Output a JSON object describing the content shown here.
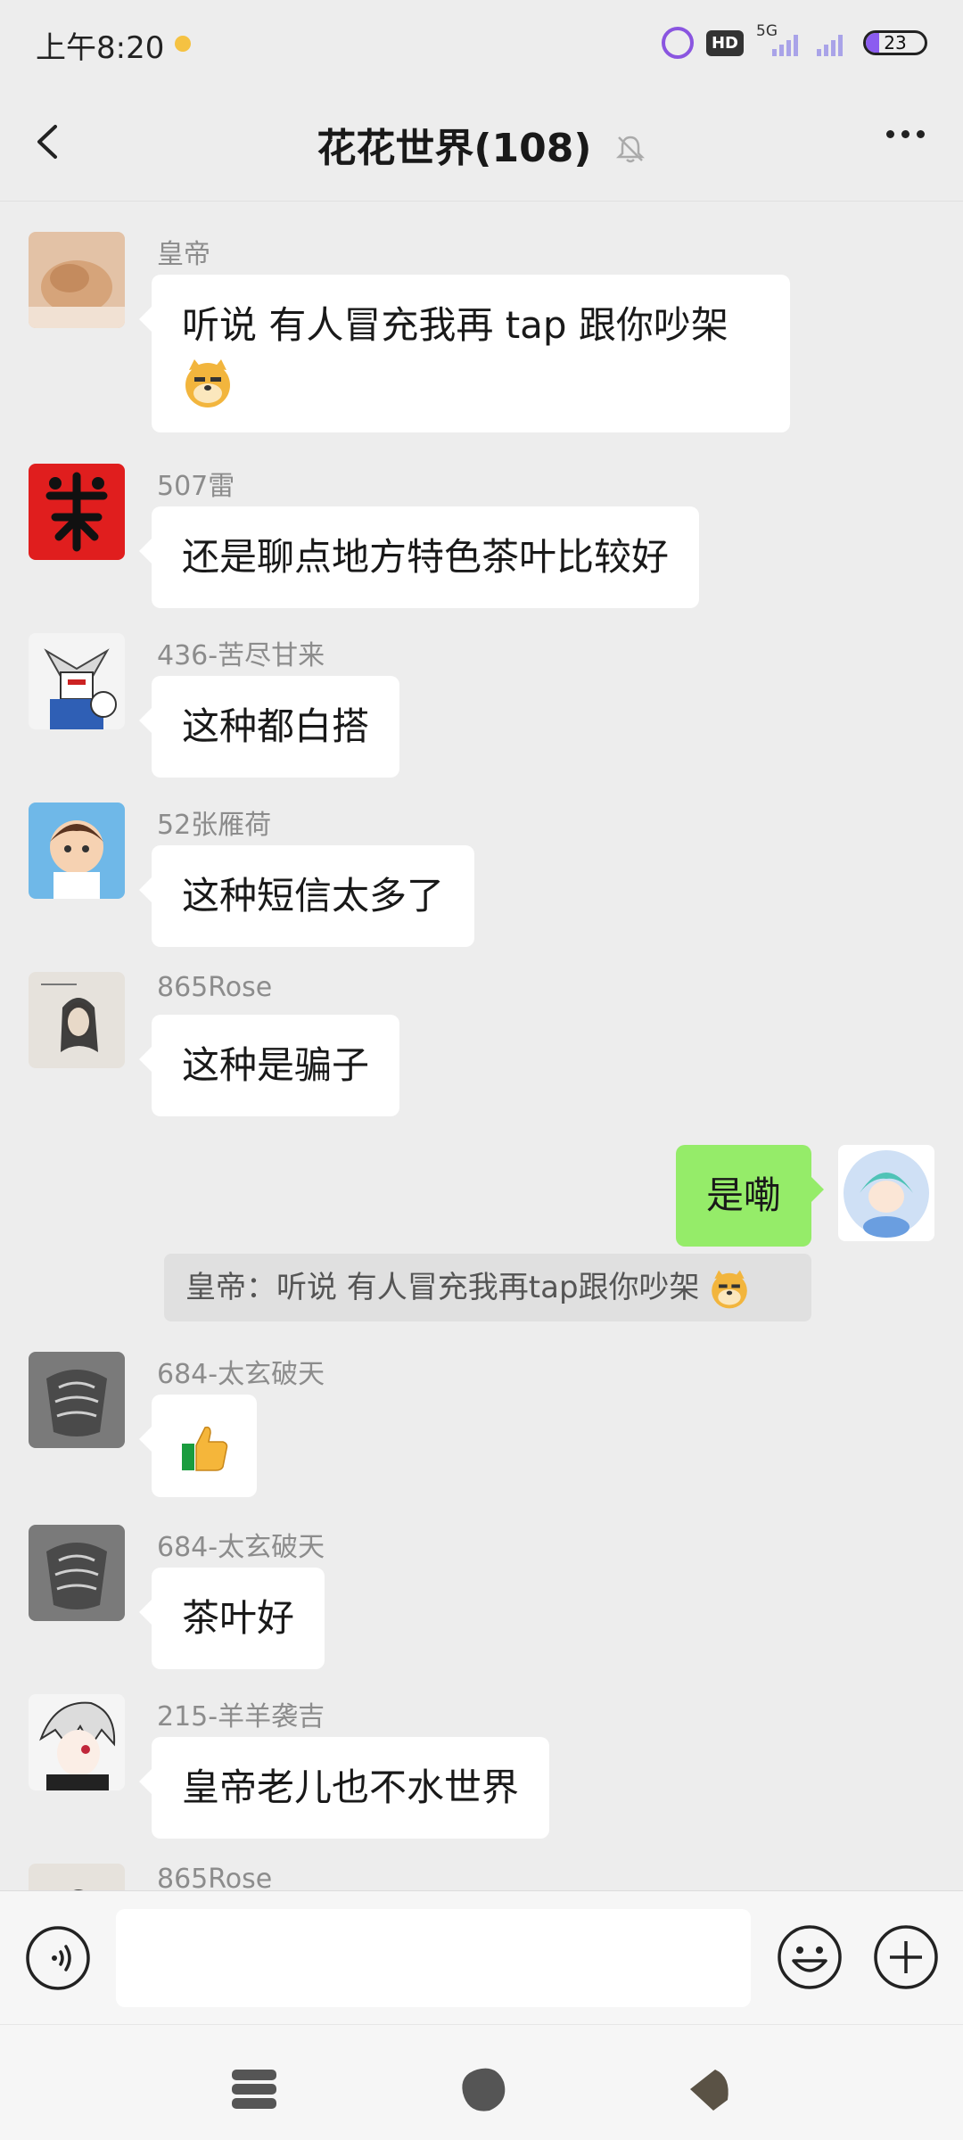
{
  "status_bar": {
    "time": "上午8:20",
    "hd_badge": "HD",
    "network": "5G",
    "battery_percent": 23,
    "battery_text": "23"
  },
  "header": {
    "title": "花花世界(108)"
  },
  "colors": {
    "background": "#ededed",
    "bubble_incoming": "#ffffff",
    "bubble_outgoing": "#95ec69",
    "sender_name": "#8c8c8c",
    "battery_fill": "#8b5cf0"
  },
  "messages": [
    {
      "sender": "皇帝",
      "text": "听说 有人冒充我再 tap 跟你吵架",
      "emoji": "doge-emoji",
      "avatar": "cat-avatar"
    },
    {
      "sender": "507雷",
      "text": "还是聊点地方特色茶叶比较好",
      "avatar": "red-calligraphy-avatar"
    },
    {
      "sender": "436-苦尽甘来",
      "text": "这种都白搭",
      "avatar": "gundam-avatar"
    },
    {
      "sender": "52张雁荷",
      "text": "这种短信太多了",
      "avatar": "cartoon-boy-avatar"
    },
    {
      "sender": "865Rose",
      "text": "这种是骗子",
      "avatar": "ink-portrait-avatar"
    },
    {
      "self": true,
      "text": "是嘞",
      "avatar": "anime-mermaid-avatar"
    },
    {
      "quote": "皇帝：听说 有人冒充我再tap跟你吵架"
    },
    {
      "sender": "684-太玄破天",
      "text": "",
      "emoji": "thumbs-up-emoji",
      "avatar": "sketch-avatar"
    },
    {
      "sender": "684-太玄破天",
      "text": "茶叶好",
      "avatar": "sketch-avatar"
    },
    {
      "sender": "215-羊羊袭吉",
      "text": "皇帝老儿也不水世界",
      "avatar": "anime-boy-avatar"
    },
    {
      "sender": "865Rose",
      "text": "",
      "avatar": "ink-portrait-avatar"
    }
  ],
  "input": {
    "value": "",
    "voice_icon": "voice-icon",
    "emoji_icon": "smiley-icon",
    "plus_icon": "plus-icon"
  },
  "bottom_bar": {
    "items": [
      "stack-icon",
      "rock-icon",
      "pebble-icon"
    ]
  }
}
